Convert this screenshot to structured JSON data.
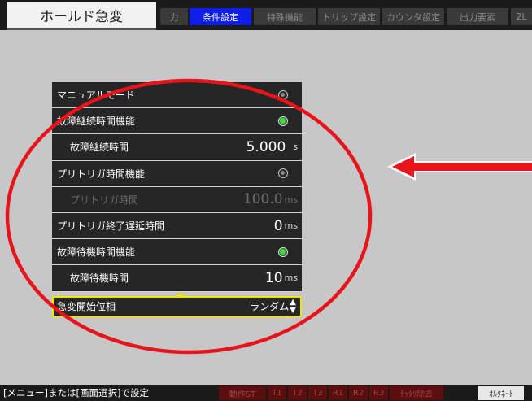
{
  "header": {
    "title": "ホールド急変",
    "tabs": [
      {
        "label": "力",
        "active": false
      },
      {
        "label": "条件設定",
        "active": true
      },
      {
        "label": "特殊機能",
        "active": false
      },
      {
        "label": "トリップ設定",
        "active": false
      },
      {
        "label": "カウンタ設定",
        "active": false
      },
      {
        "label": "出力要素",
        "active": false
      },
      {
        "label": "2L",
        "active": false
      }
    ]
  },
  "settings": {
    "manual_mode": {
      "label": "マニュアルモード",
      "state": "off"
    },
    "fault_duration_function": {
      "label": "故障継続時間機能",
      "state": "on"
    },
    "fault_duration_time": {
      "label": "故障継続時間",
      "value": "5.000",
      "unit": "s"
    },
    "pretrigger_function": {
      "label": "プリトリガ時間機能",
      "state": "off"
    },
    "pretrigger_time": {
      "label": "プリトリガ時間",
      "value": "100.0",
      "unit": "ms",
      "disabled": true
    },
    "pretrigger_end_delay": {
      "label": "プリトリガ終了遅延時間",
      "value": "0",
      "unit": "ms"
    },
    "fault_wait_function": {
      "label": "故障待機時間機能",
      "state": "on"
    },
    "fault_wait_time": {
      "label": "故障待機時間",
      "value": "10",
      "unit": "ms"
    },
    "sudden_change_phase": {
      "label": "急変開始位相",
      "value": "ランダム"
    }
  },
  "statusbar": {
    "hint": "[メニュー]または[画面選択]で設定",
    "indicators": [
      "動作ST",
      "T1",
      "T2",
      "T3",
      "R1",
      "R2",
      "R3",
      "ﾁｬﾀﾘ除去",
      "ｵﾙﾀﾈｰﾄ"
    ]
  },
  "colors": {
    "active_tab": "#0f1ee6",
    "radio_on": "#35e03c",
    "selection_border": "#f2e600",
    "annotation": "#e8141c",
    "indicator_bg": "#5a0e0e"
  },
  "icons": {
    "radio_off": "radio-off-icon",
    "radio_on": "radio-on-icon",
    "updown": "updown-arrows-icon",
    "annotation_arrow": "arrow-left-icon"
  }
}
